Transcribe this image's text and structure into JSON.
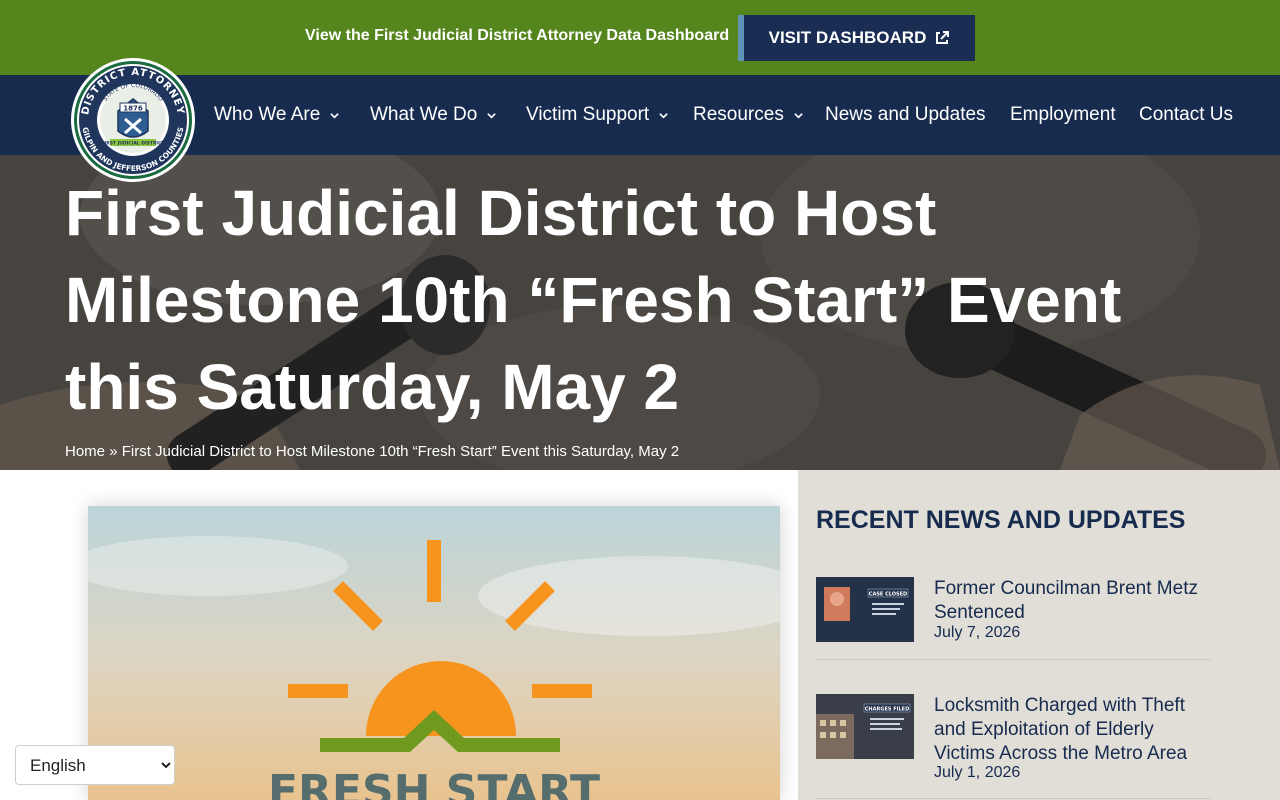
{
  "banner": {
    "text": "View the First Judicial District Attorney Data Dashboard",
    "button_label": "VISIT DASHBOARD",
    "button_icon": "external-link-icon"
  },
  "logo": {
    "top_text": "DISTRICT ATTORNEY",
    "state_text": "STATE OF COLORADO",
    "year": "1876",
    "ribbon_text": "FIRST JUDICIAL DISTRICT",
    "bottom_text": "GILPIN AND JEFFERSON COUNTIES"
  },
  "nav": {
    "items": [
      {
        "label": "Who We Are",
        "has_dropdown": true
      },
      {
        "label": "What We Do",
        "has_dropdown": true
      },
      {
        "label": "Victim Support",
        "has_dropdown": true
      },
      {
        "label": "Resources",
        "has_dropdown": true
      },
      {
        "label": "News and Updates",
        "has_dropdown": false
      },
      {
        "label": "Employment",
        "has_dropdown": false
      },
      {
        "label": "Contact Us",
        "has_dropdown": false
      }
    ]
  },
  "hero": {
    "title": "First Judicial District to Host Milestone 10th “Fresh Start” Event this Saturday, May 2",
    "breadcrumb_home": "Home",
    "breadcrumb_separator": "»",
    "breadcrumb_current": "First Judicial District to Host Milestone 10th “Fresh Start” Event this Saturday, May 2"
  },
  "feature_image": {
    "text": "FRESH START"
  },
  "sidebar": {
    "title": "RECENT NEWS AND UPDATES",
    "items": [
      {
        "title": "Former Councilman Brent Metz Sentenced",
        "date": "July 7, 2026",
        "thumb_label": "CASE CLOSED"
      },
      {
        "title": "Locksmith Charged with Theft and Exploitation of Elderly Victims Across the Metro Area",
        "date": "July 1, 2026",
        "thumb_label": "CHARGES FILED"
      }
    ]
  },
  "language": {
    "selected": "English"
  },
  "colors": {
    "banner_green": "#55861e",
    "navy": "#172b4f",
    "sidebar_bg": "#e0ded7",
    "sun_orange": "#f7941d",
    "horizon_green": "#6f9a1f"
  }
}
